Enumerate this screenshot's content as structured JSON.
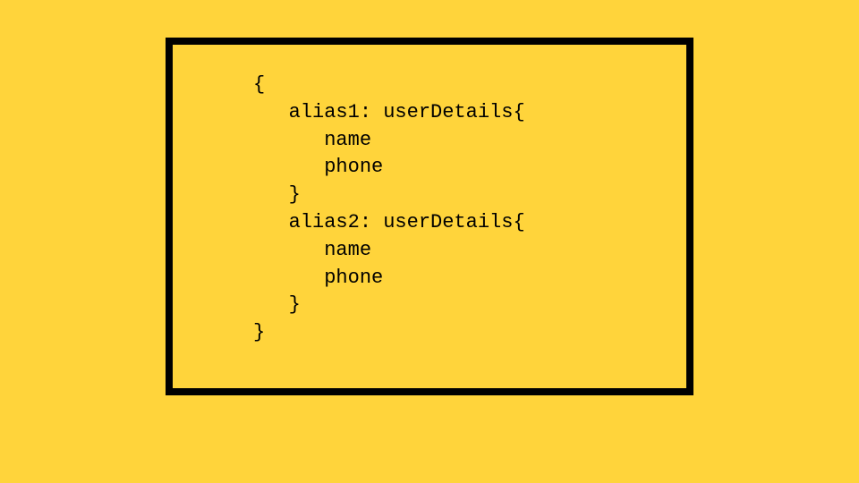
{
  "code": {
    "line1": "{",
    "line2": "   alias1: userDetails{",
    "line3": "      name",
    "line4": "      phone",
    "line5": "   }",
    "line6": "   alias2: userDetails{",
    "line7": "      name",
    "line8": "      phone",
    "line9": "   }",
    "line10": "}"
  }
}
